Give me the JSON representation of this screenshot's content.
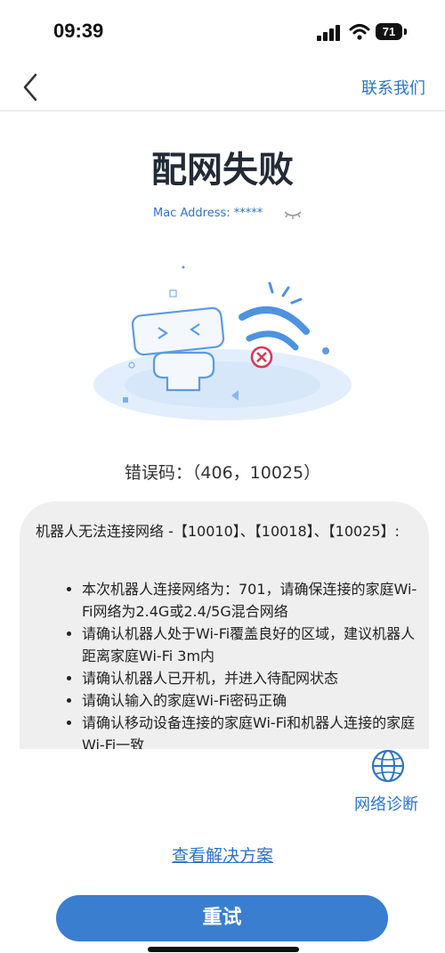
{
  "status_bar": {
    "time": "09:39",
    "battery": "71"
  },
  "nav": {
    "contact_label": "联系我们"
  },
  "page": {
    "title": "配网失败",
    "mac_address": "Mac Address: *****",
    "error_code": "错误码：（406，10025）"
  },
  "info": {
    "header": "机器人无法连接网络 -【10010】、【10018】、【10025】:",
    "items": [
      "本次机器人连接网络为：701，请确保连接的家庭Wi-Fi网络为2.4G或2.4/5G混合网络",
      "请确认机器人处于Wi-Fi覆盖良好的区域，建议机器人距离家庭Wi-Fi 3m内",
      "请确认机器人已开机，并进入待配网状态",
      "请确认输入的家庭Wi-Fi密码正确",
      "请确认移动设备连接的家庭Wi-Fi和机器人连接的家庭Wi-Fi一致"
    ]
  },
  "actions": {
    "diagnose_label": "网络诊断",
    "solution_label": "查看解决方案",
    "retry_label": "重试"
  },
  "icons": {
    "back": "chevron-left-icon",
    "eye": "eye-closed-icon",
    "diagnose": "globe-icon"
  },
  "colors": {
    "accent": "#2f74c4",
    "button": "#3a7ecf",
    "card_bg": "#efefef"
  }
}
